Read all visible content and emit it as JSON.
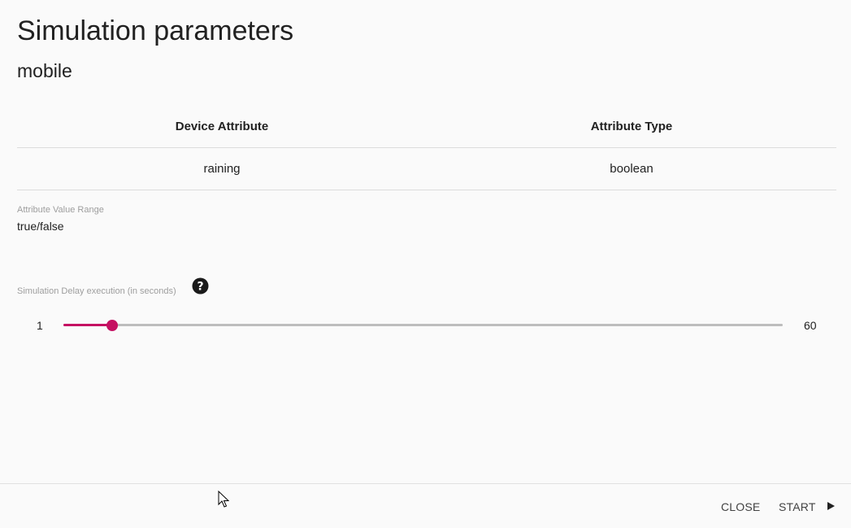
{
  "dialog": {
    "title": "Simulation parameters",
    "subtitle": "mobile"
  },
  "table": {
    "headers": [
      "Device Attribute",
      "Attribute Type"
    ],
    "rows": [
      [
        "raining",
        "boolean"
      ]
    ]
  },
  "range": {
    "label": "Attribute Value Range",
    "value": "true/false"
  },
  "delay": {
    "label": "Simulation Delay execution (in seconds)",
    "help_icon": "question-circle-icon",
    "min": "1",
    "max": "60",
    "current_value": 5,
    "accent_color": "#c51162"
  },
  "footer": {
    "close_label": "CLOSE",
    "start_label": "START",
    "start_icon": "play-icon"
  }
}
